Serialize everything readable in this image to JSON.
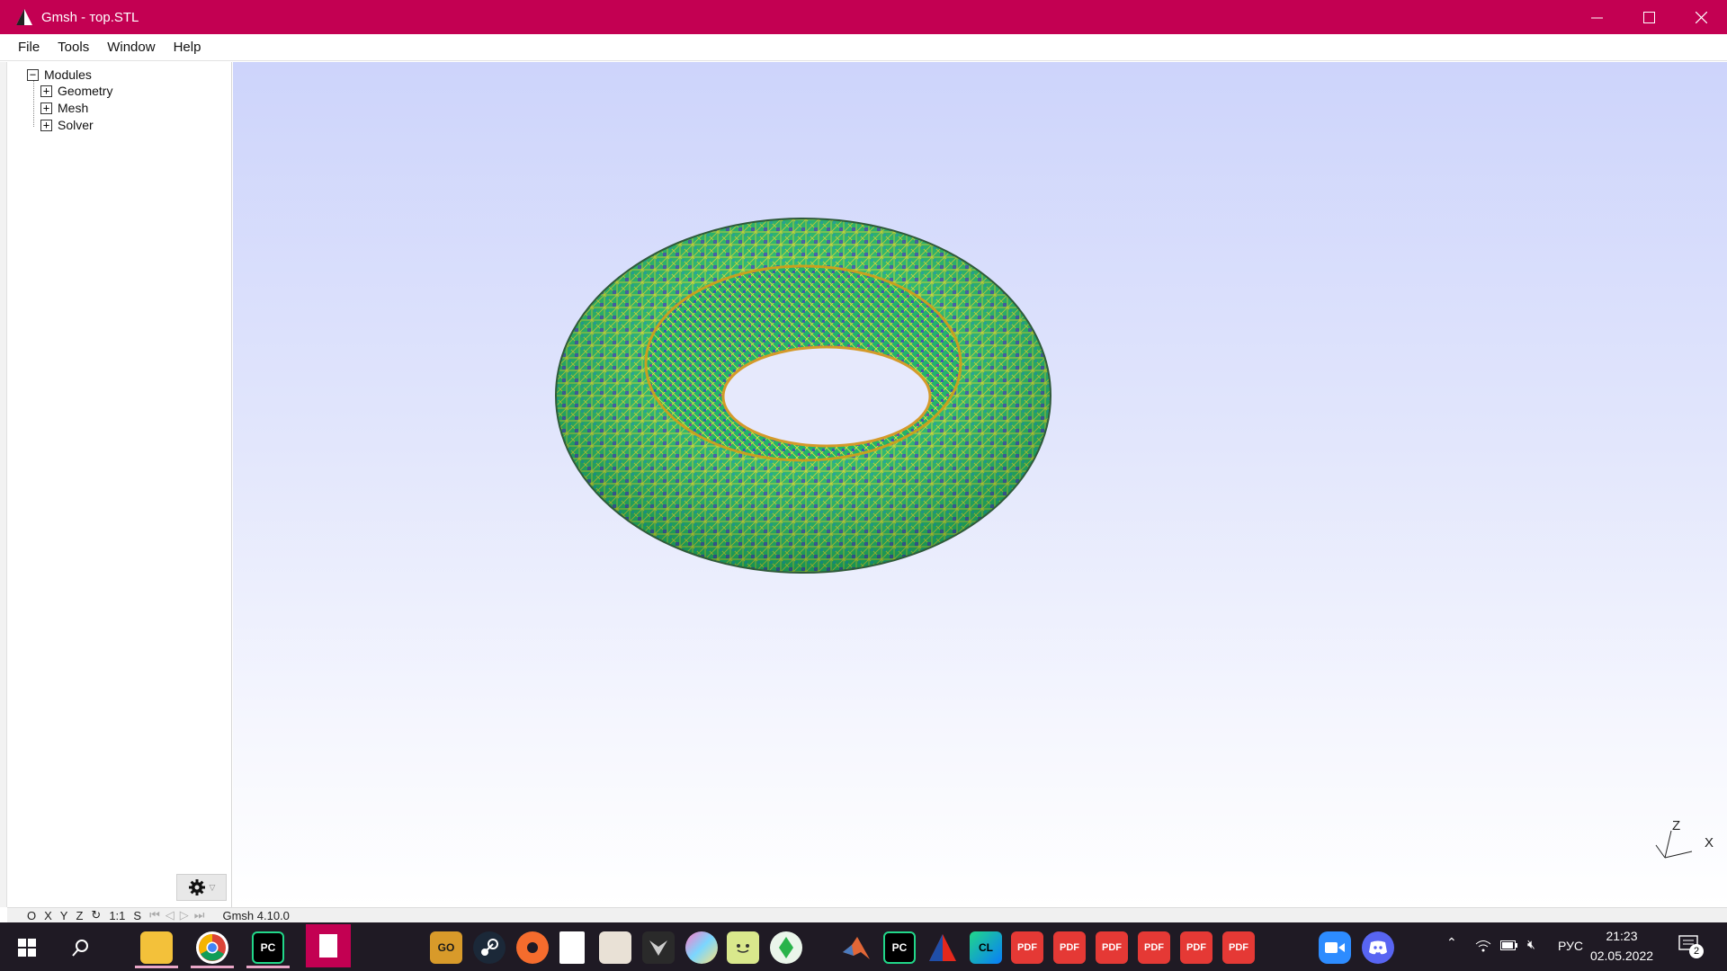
{
  "window": {
    "title": "Gmsh - тор.STL",
    "title_bar_color": "#c30052"
  },
  "menu": {
    "file": "File",
    "tools": "Tools",
    "window": "Window",
    "help": "Help"
  },
  "tree": {
    "modules": "Modules",
    "geometry": "Geometry",
    "mesh": "Mesh",
    "solver": "Solver"
  },
  "viewport": {
    "axis_z": "Z",
    "axis_x": "X",
    "mesh_colors": [
      "#1fbf6a",
      "#d7e02a",
      "#3b3fbf",
      "#1aa7a0",
      "#7a2fb0"
    ]
  },
  "statusbar": {
    "o": "O",
    "x": "X",
    "y": "Y",
    "z": "Z",
    "rotate": "↻",
    "scale_1_1": "1:1",
    "s": "S",
    "version": "Gmsh 4.10.0"
  },
  "taskbar": {
    "time": "21:23",
    "date": "02.05.2022",
    "language": "РУС",
    "notification_count": "2",
    "pdf_label": "PDF",
    "icons": [
      "windows-start-icon",
      "search-icon",
      "file-explorer-icon",
      "chrome-icon",
      "pycharm-icon",
      "notepad-icon",
      "csgo-icon",
      "steam-icon",
      "origin-icon",
      "blank-document-icon",
      "game-avatar-icon",
      "witcher-icon",
      "rainbow-app-icon",
      "face-app-icon",
      "sims-icon",
      "matlab-icon",
      "pycharm-icon-2",
      "gmsh-icon",
      "clion-icon",
      "pdf-icon",
      "zoom-icon",
      "discord-icon"
    ]
  }
}
